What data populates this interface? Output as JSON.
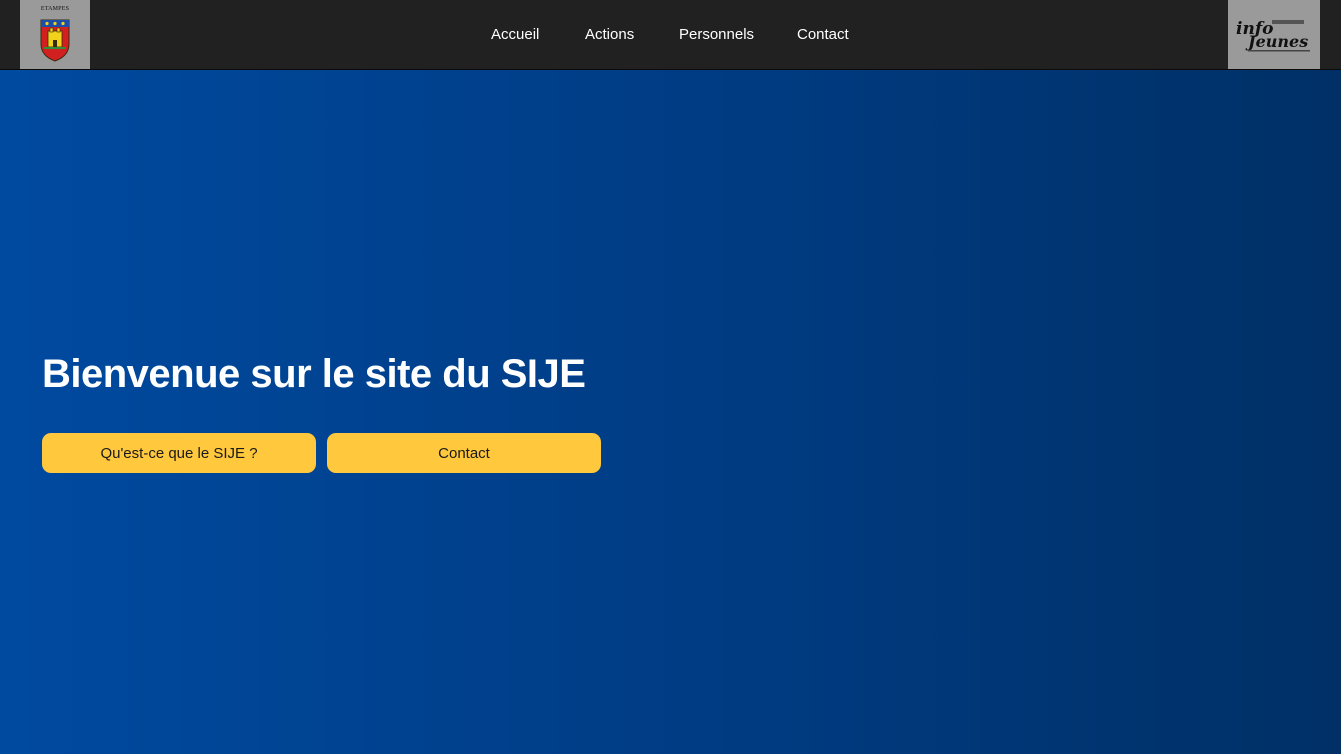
{
  "header": {
    "left_logo": {
      "wordmark": "ETAMPES",
      "icon": "etampes-crest-icon"
    },
    "right_logo": {
      "icon": "info-jeunes-logo-icon",
      "wordmark": "info jeunes"
    },
    "nav": {
      "accueil": "Accueil",
      "actions": "Actions",
      "personnels": "Personnels",
      "contact": "Contact"
    }
  },
  "hero": {
    "title": "Bienvenue sur le site du SIJE",
    "buttons": {
      "sije": "Qu'est-ce que le SIJE ?",
      "contact": "Contact"
    }
  },
  "colors": {
    "topbar": "#212121",
    "background_start": "#004aa0",
    "background_end": "#003066",
    "button": "#ffc83d",
    "logo_tile": "#9a9a9a"
  }
}
